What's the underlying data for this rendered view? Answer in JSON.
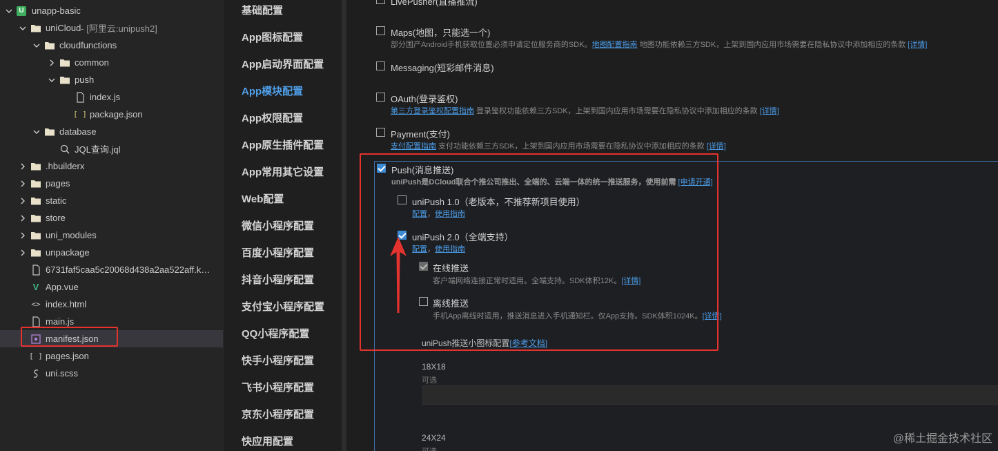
{
  "file_tree": {
    "project": {
      "name": "unapp-basic",
      "badge": "U"
    },
    "items": [
      {
        "label": "uniCloud",
        "suffix": " - [阿里云:unipush2]"
      },
      {
        "label": "cloudfunctions"
      },
      {
        "label": "common"
      },
      {
        "label": "push"
      },
      {
        "label": "index.js"
      },
      {
        "label": "package.json"
      },
      {
        "label": "database"
      },
      {
        "label": "JQL查询.jql"
      },
      {
        "label": ".hbuilderx"
      },
      {
        "label": "pages"
      },
      {
        "label": "static"
      },
      {
        "label": "store"
      },
      {
        "label": "uni_modules"
      },
      {
        "label": "unpackage"
      },
      {
        "label": "6731faf5caa5c20068d438a2aa522aff.key..."
      },
      {
        "label": "App.vue"
      },
      {
        "label": "index.html"
      },
      {
        "label": "main.js"
      },
      {
        "label": "manifest.json"
      },
      {
        "label": "pages.json"
      },
      {
        "label": "uni.scss"
      }
    ]
  },
  "settings_nav": {
    "items": [
      "基础配置",
      "App图标配置",
      "App启动界面配置",
      "App模块配置",
      "App权限配置",
      "App原生插件配置",
      "App常用其它设置",
      "Web配置",
      "微信小程序配置",
      "百度小程序配置",
      "抖音小程序配置",
      "支付宝小程序配置",
      "QQ小程序配置",
      "快手小程序配置",
      "飞书小程序配置",
      "京东小程序配置",
      "快应用配置"
    ],
    "active": "App模块配置"
  },
  "modules": {
    "livepusher": {
      "title": "LivePusher(直播推流)"
    },
    "maps": {
      "title": "Maps(地图，只能选一个)",
      "desc": "部分国产Android手机获取位置必须申请定位服务商的SDK。",
      "link": "地图配置指南",
      "desc2": " 地图功能依赖三方SDK，上架到国内应用市场需要在隐私协议中添加相应的条款 ",
      "detail": "[详情]"
    },
    "messaging": {
      "title": "Messaging(短彩邮件消息)"
    },
    "oauth": {
      "title": "OAuth(登录鉴权)",
      "link": "第三方登录鉴权配置指南",
      "desc": " 登录鉴权功能依赖三方SDK，上架到国内应用市场需要在隐私协议中添加相应的条款 ",
      "detail": "[详情]"
    },
    "payment": {
      "title": "Payment(支付)",
      "link": "支付配置指南",
      "desc": " 支付功能依赖三方SDK，上架到国内应用市场需要在隐私协议中添加相应的条款 ",
      "detail": "[详情]"
    },
    "push": {
      "title": "Push(消息推送)",
      "desc_bold": "uniPush是DCloud联合个推公司推出、全端的、云端一体的统一推送服务，使用前需 ",
      "desc_link": "[申请开通]",
      "unipush1": {
        "title": "uniPush 1.0（老版本，不推荐新项目使用）",
        "link_config": "配置",
        "sep": "，",
        "link_guide": "使用指南"
      },
      "unipush2": {
        "title": "uniPush 2.0（全端支持）",
        "link_config": "配置",
        "sep": "，",
        "link_guide": "使用指南"
      },
      "online": {
        "title": "在线推送",
        "desc": "客户端网络连接正常时适用。全端支持。SDK体积12K。",
        "detail": "[详情]"
      },
      "offline": {
        "title": "离线推送",
        "desc": "手机App离线时适用，推送消息进入手机通知栏。仅App支持。SDK体积1024K。",
        "detail": "[详情]"
      },
      "icon_config": {
        "title": "uniPush推送小图标配置",
        "link": "[参考文档]"
      },
      "size18": {
        "label": "18X18",
        "sub": "可选"
      },
      "size24": {
        "label": "24X24",
        "sub": "可选"
      }
    }
  },
  "watermark": "@稀土掘金技术社区",
  "colors": {
    "accent": "#3d8bd4",
    "annotation": "#e4332f",
    "link": "#4b9be6"
  }
}
